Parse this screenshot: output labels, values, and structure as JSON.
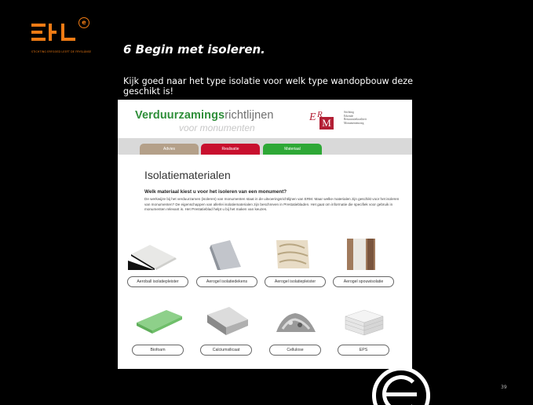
{
  "logo": {
    "tagline": "STICHTING ERFGOED LEEFT DE FRYSLÂNSE",
    "accent": "#f07b14"
  },
  "slide": {
    "title": "6 Begin met isoleren.",
    "subtitle": "Kijk goed naar het type isolatie voor welk type wandopbouw deze geschikt is!",
    "page_number": "39"
  },
  "site": {
    "brand_bold": "Verduurzamings",
    "brand_rest": "richtlijnen",
    "brand_sub": "voor monumenten",
    "erm_e": "E",
    "erm_r": "R",
    "erm_m": "M",
    "erm_lines": [
      "Stichting",
      "Erkende",
      "Restauratiekwaliteit",
      "Monumentenzorg"
    ],
    "tabs": [
      {
        "label": "Advies",
        "color": "#b4a089"
      },
      {
        "label": "Realisatie",
        "color": "#c8102e"
      },
      {
        "label": "Materiaal",
        "color": "#2ea836"
      }
    ],
    "heading": "Isolatiematerialen",
    "question": "Welk materiaal kiest u voor het isoleren van een monument?",
    "paragraph": "De werkwijze bij het verduurzamen (isoleren) van monumenten staat in de uitvoeringsrichtlijnen van ERM. Maar welke materialen zijn geschikt voor het isoleren van monumenten? De eigenschappen van allerlei isolatiematerialen zijn beschreven in Prestatiebladen. Het gaat om informatie die specifiek voor gebruik in monumenten relevant is. Het Prestatieblad helpt u bij het maken van keuzes.",
    "products": [
      {
        "label": "Aeroball isolatiepleister",
        "icon": "aeroball-image"
      },
      {
        "label": "Aerogel isolatiedekens",
        "icon": "aerogel-blanket-image"
      },
      {
        "label": "Aerogel isolatiepleister",
        "icon": "aerogel-plaster-image"
      },
      {
        "label": "Aerogel spouwisolatie",
        "icon": "aerogel-cavity-image"
      },
      {
        "label": "Biofoam",
        "icon": "biofoam-image"
      },
      {
        "label": "Calciumsilicaat",
        "icon": "calciumsilicate-image"
      },
      {
        "label": "Cellulose",
        "icon": "cellulose-image"
      },
      {
        "label": "EPS",
        "icon": "eps-image"
      }
    ]
  }
}
